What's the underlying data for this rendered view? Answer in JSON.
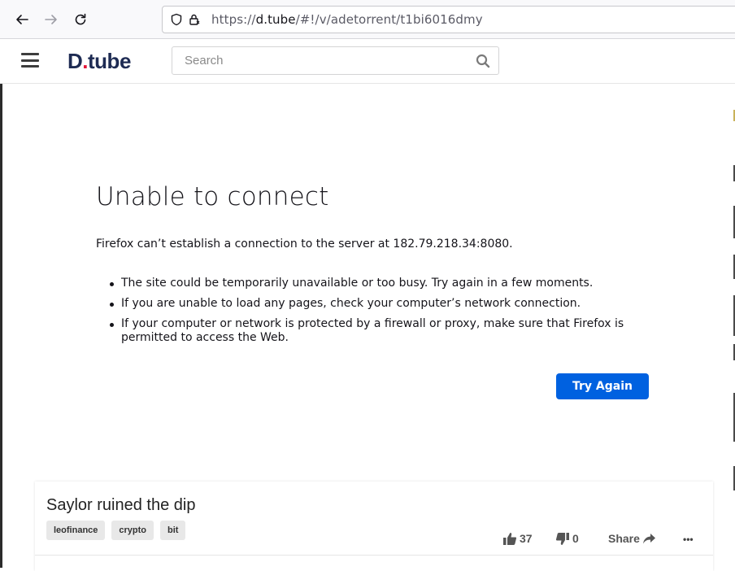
{
  "browser": {
    "url_prefix": "https://",
    "url_domain": "d.tube",
    "url_path": "/#!/v/adetorrent/t1bi6016dmy"
  },
  "site": {
    "logo_main": "D",
    "logo_dot": ".",
    "logo_rest": "tube",
    "search_placeholder": "Search",
    "brand_color": "#1e2b53",
    "accent_color": "#e31337"
  },
  "error": {
    "title": "Unable to connect",
    "description": "Firefox can’t establish a connection to the server at 182.79.218.34:8080.",
    "bullets": [
      "The site could be temporarily unavailable or too busy. Try again in a few moments.",
      "If you are unable to load any pages, check your computer’s network connection.",
      "If your computer or network is protected by a firewall or proxy, make sure that Firefox is permitted to access the Web."
    ],
    "button_label": "Try Again",
    "button_color": "#0061e0"
  },
  "video": {
    "title": "Saylor ruined the dip",
    "tags": [
      "leofinance",
      "crypto",
      "bit"
    ],
    "likes": "37",
    "dislikes": "0",
    "share_label": "Share",
    "more_label": "•••"
  }
}
